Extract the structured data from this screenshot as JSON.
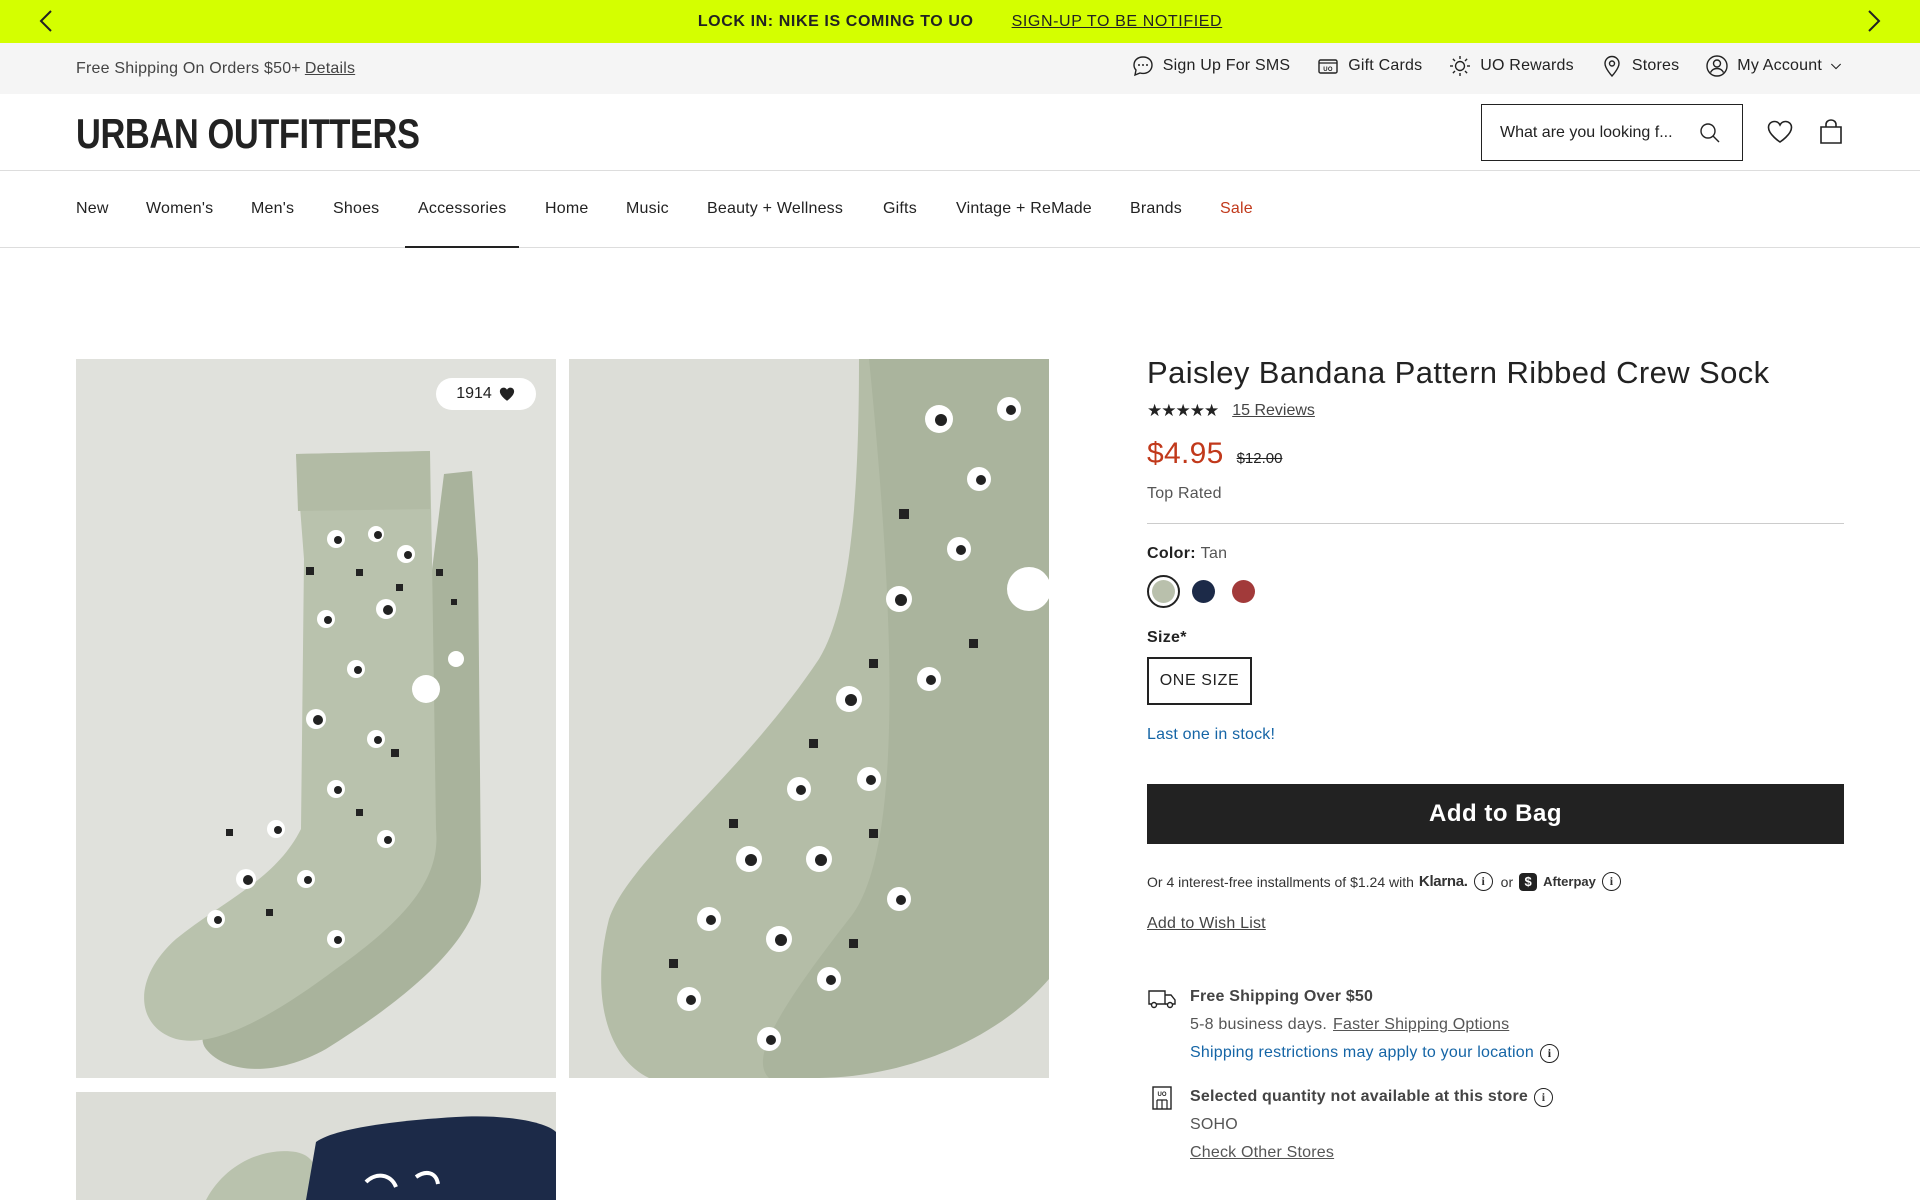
{
  "promo": {
    "text": "LOCK IN: NIKE IS COMING TO UO",
    "link": "SIGN-UP TO BE NOTIFIED"
  },
  "utility": {
    "shipping_note": "Free Shipping On Orders $50+",
    "details_link": "Details",
    "links": [
      "Sign Up For SMS",
      "Gift Cards",
      "UO Rewards",
      "Stores",
      "My Account"
    ]
  },
  "header": {
    "logo": "URBAN OUTFITTERS",
    "search_placeholder": "What are you looking f..."
  },
  "nav": {
    "items": [
      "New",
      "Women's",
      "Men's",
      "Shoes",
      "Accessories",
      "Home",
      "Music",
      "Beauty + Wellness",
      "Gifts",
      "Vintage + ReMade",
      "Brands",
      "Sale"
    ],
    "active": "Accessories"
  },
  "gallery": {
    "likes": "1914"
  },
  "product": {
    "title": "Paisley Bandana Pattern Ribbed Crew Sock",
    "stars": "★★★★★",
    "reviews": "15 Reviews",
    "price": "$4.95",
    "original_price": "$12.00",
    "badge": "Top Rated",
    "color_label": "Color:",
    "color_value": "Tan",
    "swatches": [
      "#b9c0ac",
      "#1c2a48",
      "#a23a3a"
    ],
    "size_label": "Size*",
    "size_value": "ONE SIZE",
    "stock": "Last one in stock!",
    "add_to_bag": "Add to Bag",
    "installments_text": "Or 4 interest-free installments of $1.24 with",
    "klarna": "Klarna.",
    "or": "or",
    "afterpay": "Afterpay",
    "wishlist": "Add to Wish List"
  },
  "shipping": {
    "title": "Free Shipping Over $50",
    "days": "5-8 business days.",
    "faster_link": "Faster Shipping Options",
    "restrictions": "Shipping restrictions may apply to your location"
  },
  "store": {
    "title": "Selected quantity not available at this store",
    "name": "SOHO",
    "check_link": "Check Other Stores"
  },
  "colors": {
    "promo_bg": "#d4ff00",
    "sale_red": "#c1391b",
    "link_blue": "#1565a6"
  }
}
